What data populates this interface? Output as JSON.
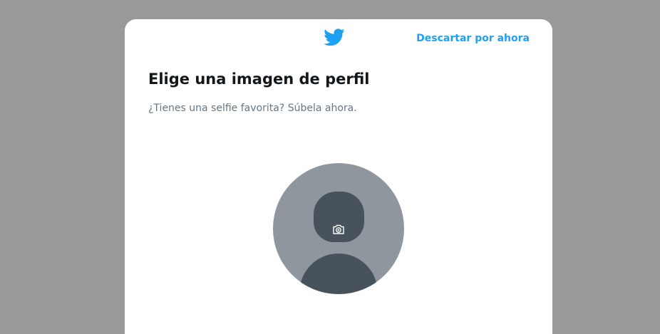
{
  "header": {
    "logo_icon": "twitter-bird-icon",
    "skip_label": "Descartar por ahora"
  },
  "main": {
    "title": "Elige una imagen de perfil",
    "subtitle": "¿Tienes una selfie favorita? Súbela ahora.",
    "avatar_icon": "camera-add-icon"
  },
  "colors": {
    "accent": "#1da1f2",
    "backdrop": "#999999",
    "avatar_bg": "#8f969d",
    "avatar_silhouette": "#47525c"
  }
}
